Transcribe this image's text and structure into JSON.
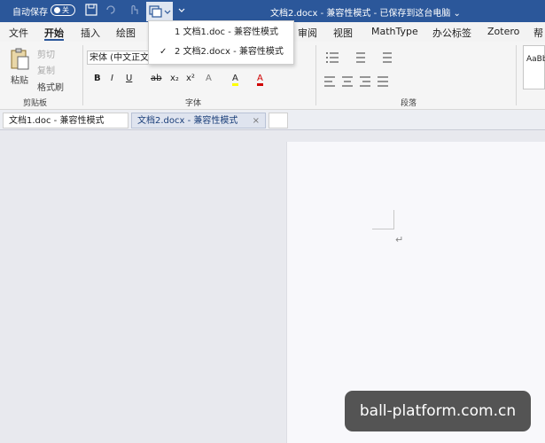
{
  "titlebar": {
    "autosave_label": "自动保存",
    "toggle_state": "关",
    "document_title": "文档2.docx - 兼容性模式 - 已保存到这台电脑 ⌄"
  },
  "menu": {
    "tabs": [
      "文件",
      "开始",
      "插入",
      "绘图",
      "审阅",
      "视图",
      "MathType",
      "办公标签",
      "Zotero",
      "帮"
    ],
    "active": "开始"
  },
  "ribbon": {
    "clipboard": {
      "paste": "粘贴",
      "cut": "剪切",
      "copy": "复制",
      "format_painter": "格式刷",
      "label": "剪贴板"
    },
    "font": {
      "font_name": "宋体 (中文正文)",
      "label": "字体",
      "buttons": [
        "B",
        "I",
        "U",
        "ab",
        "x₂",
        "x²",
        "A",
        "A",
        "A"
      ]
    },
    "paragraph": {
      "label": "段落"
    },
    "style_preview": "AaBb"
  },
  "doc_tabs": [
    {
      "label": "文档1.doc - 兼容性模式"
    },
    {
      "label": "文档2.docx - 兼容性模式"
    }
  ],
  "window_menu": [
    {
      "label": "1 文档1.doc - 兼容性模式",
      "checked": false
    },
    {
      "label": "2 文档2.docx - 兼容性模式",
      "checked": true
    }
  ],
  "document": {
    "paragraph_mark": "↵"
  },
  "watermark": "ball-platform.com.cn",
  "colors": {
    "title_bar": "#2b579a",
    "highlight": "#ffff00",
    "font_color": "#d00000"
  }
}
